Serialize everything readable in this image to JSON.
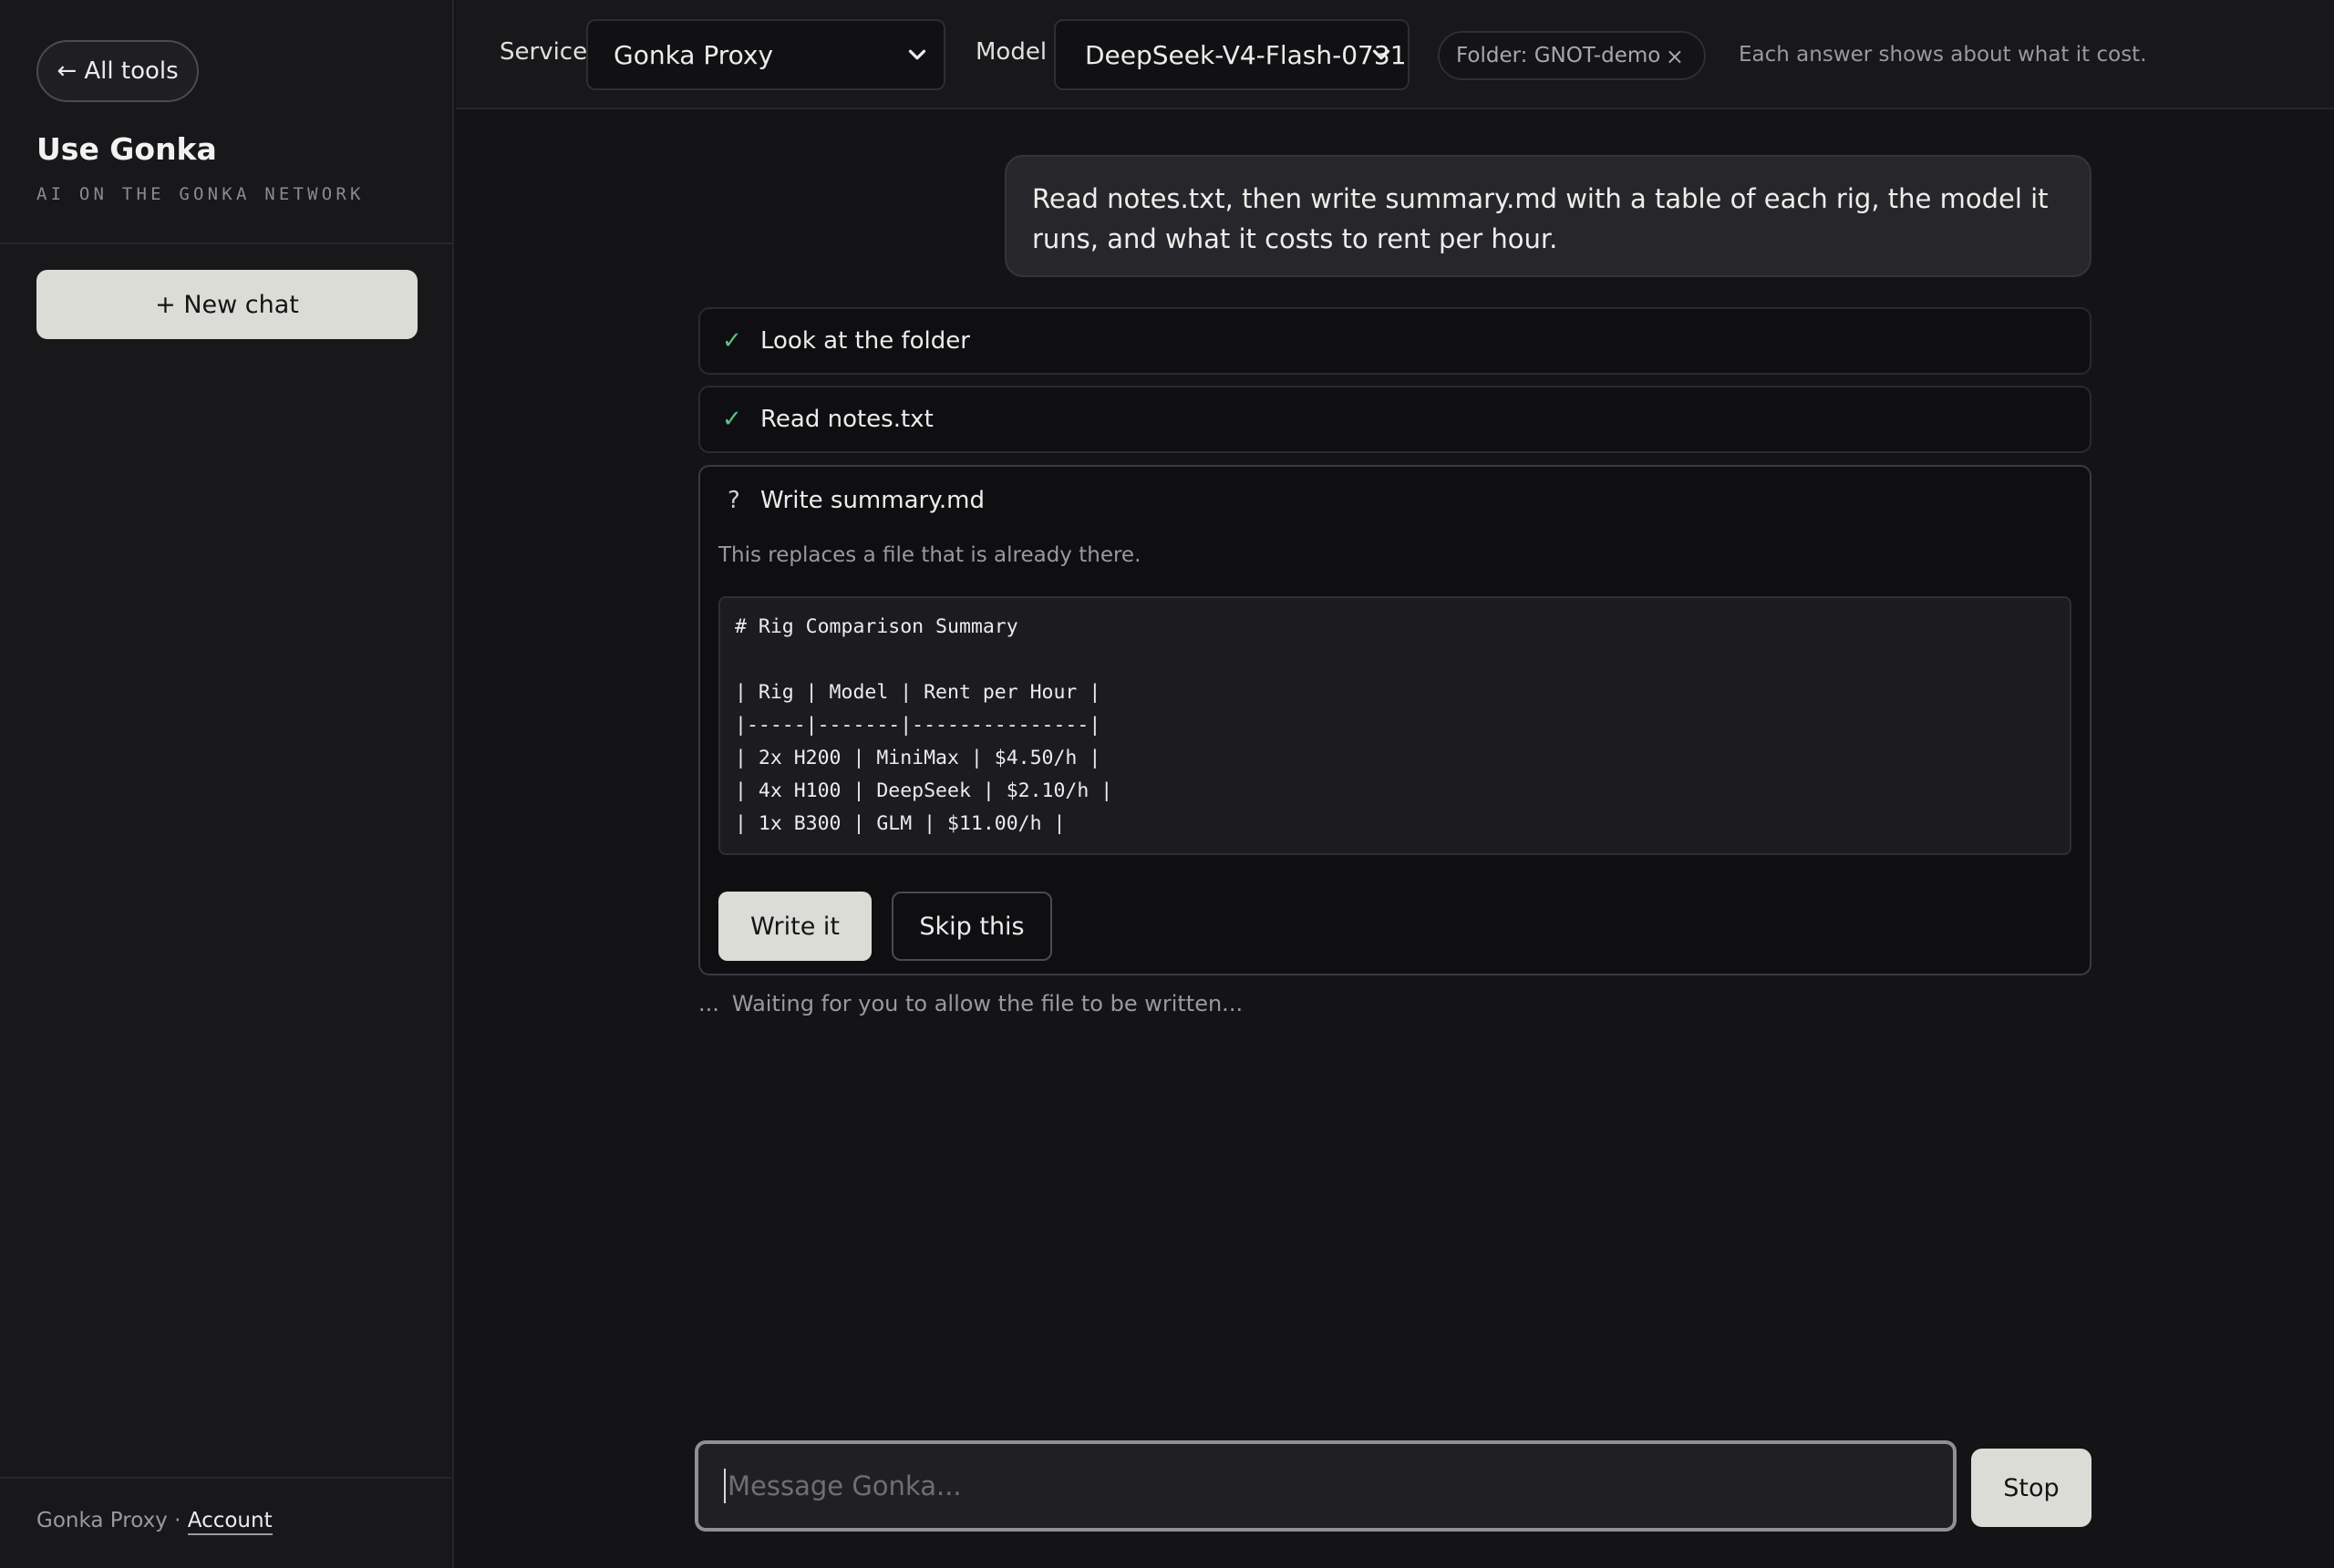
{
  "sidebar": {
    "back_label": "← All tools",
    "title": "Use Gonka",
    "subtitle": "AI ON THE GONKA NETWORK",
    "new_chat_label": "+ New chat",
    "footer_service": "Gonka Proxy ·",
    "footer_account": "Account"
  },
  "topbar": {
    "service_label": "Service",
    "service_value": "Gonka Proxy",
    "model_label": "Model",
    "model_value": "DeepSeek-V4-Flash-0731",
    "folder_chip": "Folder: GNOT-demo",
    "folder_close": "×",
    "hint": "Each answer shows about what it cost."
  },
  "chat": {
    "user_message": "Read notes.txt, then write summary.md with a table of each rig, the model it runs, and what it costs to rent per hour.",
    "steps": [
      {
        "status": "done",
        "icon": "✓",
        "label": "Look at the folder"
      },
      {
        "status": "done",
        "icon": "✓",
        "label": "Read notes.txt"
      },
      {
        "status": "pending",
        "icon": "?",
        "label": "Write summary.md",
        "note": "This replaces a file that is already there.",
        "code": "# Rig Comparison Summary\n\n| Rig | Model | Rent per Hour |\n|-----|-------|---------------|\n| 2x H200 | MiniMax | $4.50/h |\n| 4x H100 | DeepSeek | $2.10/h |\n| 1x B300 | GLM | $11.00/h |",
        "confirm_label": "Write it",
        "skip_label": "Skip this"
      }
    ],
    "status_dots": "...",
    "status_text": "Waiting for you to allow the file to be written..."
  },
  "composer": {
    "placeholder": "Message Gonka...",
    "stop_label": "Stop"
  },
  "colors": {
    "background": "#141417",
    "sidebar": "#18181b",
    "accent_button": "#dcdcd6",
    "check": "#5fbf86"
  },
  "icons": {
    "back": "arrow-left-icon",
    "dropdown": "chevron-down-icon",
    "close": "close-icon",
    "done": "check-icon",
    "pending": "question-icon"
  }
}
